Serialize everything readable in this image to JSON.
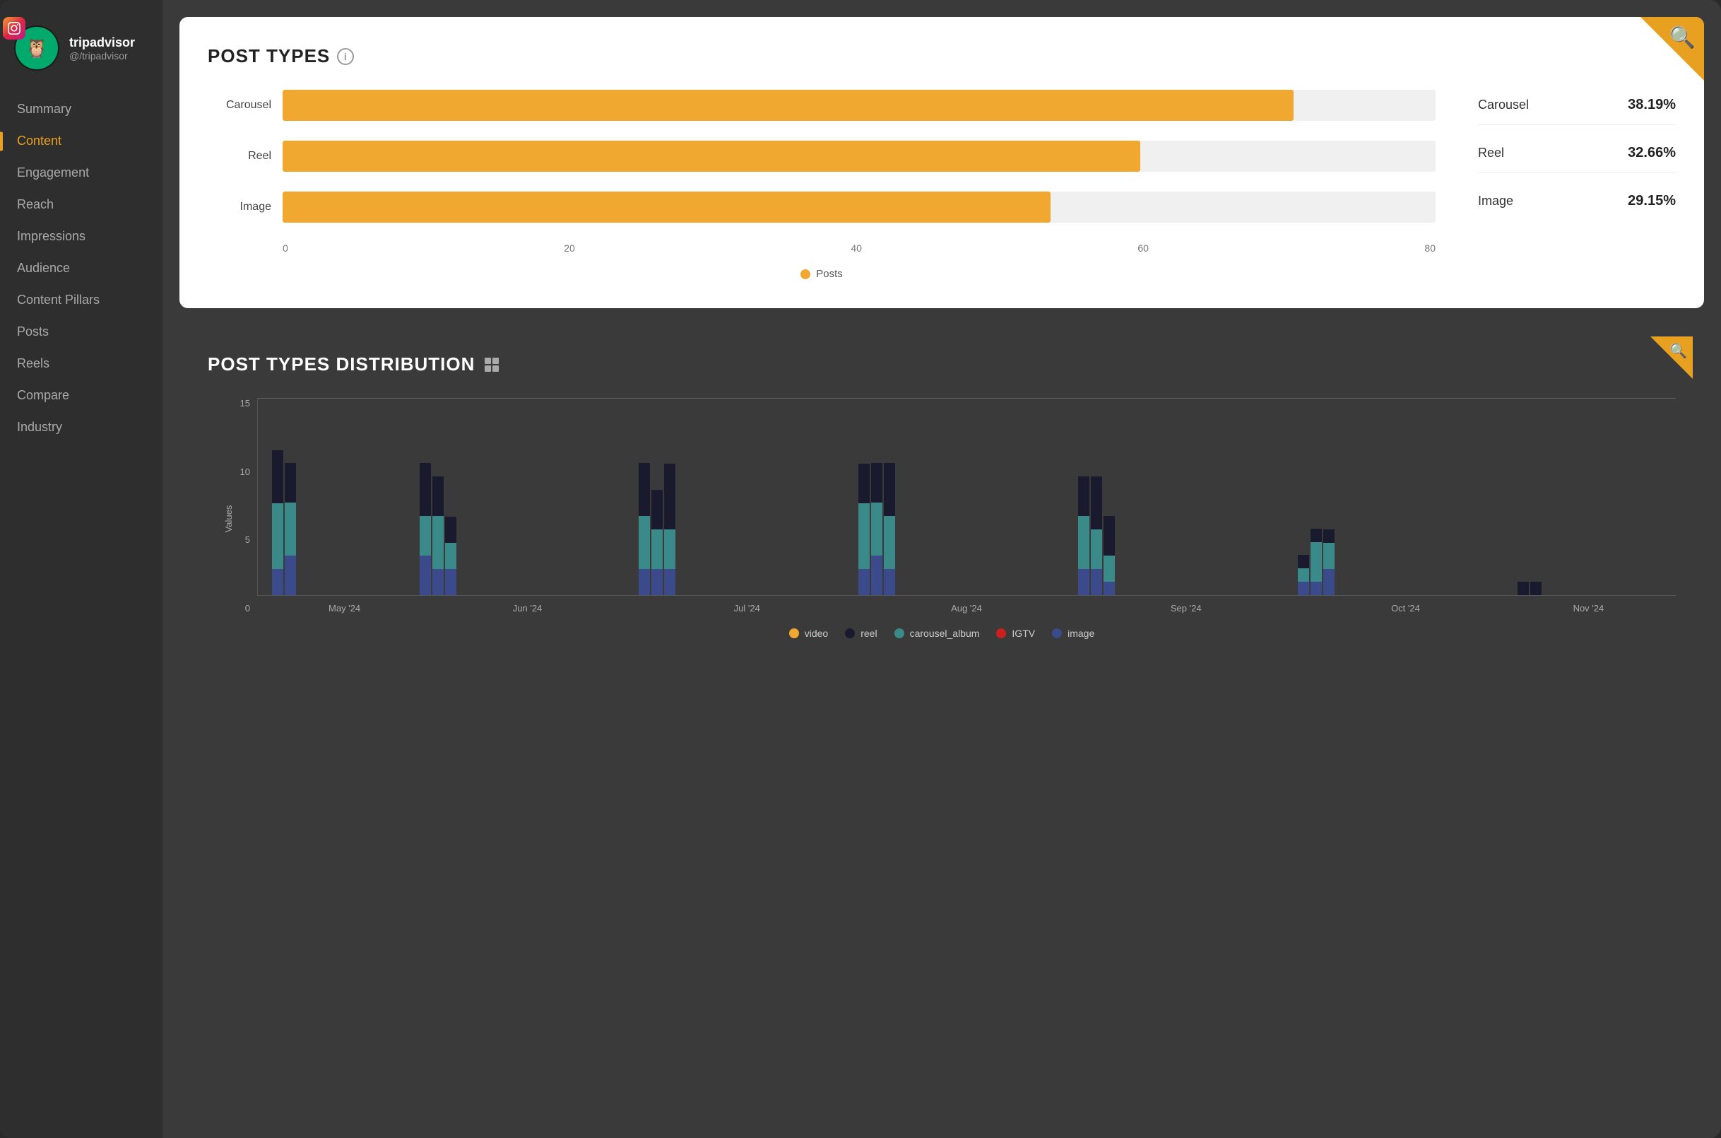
{
  "app": {
    "bg_color": "#2e2e2e"
  },
  "profile": {
    "name": "tripadvisor",
    "handle": "@/tripadvisor",
    "platform": "instagram"
  },
  "sidebar": {
    "items": [
      {
        "id": "summary",
        "label": "Summary",
        "active": false
      },
      {
        "id": "content",
        "label": "Content",
        "active": true
      },
      {
        "id": "engagement",
        "label": "Engagement",
        "active": false
      },
      {
        "id": "reach",
        "label": "Reach",
        "active": false
      },
      {
        "id": "impressions",
        "label": "Impressions",
        "active": false
      },
      {
        "id": "audience",
        "label": "Audience",
        "active": false
      },
      {
        "id": "content-pillars",
        "label": "Content Pillars",
        "active": false
      },
      {
        "id": "posts",
        "label": "Posts",
        "active": false
      },
      {
        "id": "reels",
        "label": "Reels",
        "active": false
      },
      {
        "id": "compare",
        "label": "Compare",
        "active": false
      },
      {
        "id": "industry",
        "label": "Industry",
        "active": false
      }
    ]
  },
  "post_types": {
    "title": "POST TYPES",
    "bars": [
      {
        "label": "Carousel",
        "value": 79,
        "max": 90
      },
      {
        "label": "Reel",
        "value": 67,
        "max": 90
      },
      {
        "label": "Image",
        "value": 60,
        "max": 90
      }
    ],
    "x_axis": [
      "0",
      "20",
      "40",
      "60",
      "80"
    ],
    "legend_label": "Posts",
    "stats": [
      {
        "name": "Carousel",
        "value": "38.19%"
      },
      {
        "name": "Reel",
        "value": "32.66%"
      },
      {
        "name": "Image",
        "value": "29.15%"
      }
    ]
  },
  "distribution": {
    "title": "POST TYPES DISTRIBUTION",
    "y_labels": [
      "15",
      "10",
      "5",
      "0"
    ],
    "y_axis_label": "Values",
    "x_labels": [
      "May '24",
      "Jun '24",
      "Jul '24",
      "Aug '24",
      "Sep '24",
      "Oct '24",
      "Nov '24"
    ],
    "legend": [
      {
        "name": "video",
        "color": "#f0a830"
      },
      {
        "name": "reel",
        "color": "#1a1a2e"
      },
      {
        "name": "carousel_album",
        "color": "#3a8a8a"
      },
      {
        "name": "IGTV",
        "color": "#cc2020"
      },
      {
        "name": "image",
        "color": "#3a4a8a"
      }
    ],
    "groups": [
      {
        "month": "May '24",
        "bars": [
          {
            "video": 0,
            "reel": 4,
            "carousel": 5,
            "igtv": 0,
            "image": 2
          },
          {
            "video": 0,
            "reel": 3,
            "carousel": 4,
            "igtv": 0,
            "image": 3
          }
        ]
      },
      {
        "month": "Jun '24",
        "bars": [
          {
            "video": 0,
            "reel": 4,
            "carousel": 3,
            "igtv": 0,
            "image": 3
          },
          {
            "video": 0,
            "reel": 3,
            "carousel": 4,
            "igtv": 0,
            "image": 2
          },
          {
            "video": 0,
            "reel": 2,
            "carousel": 2,
            "igtv": 0,
            "image": 2
          }
        ]
      }
    ]
  }
}
